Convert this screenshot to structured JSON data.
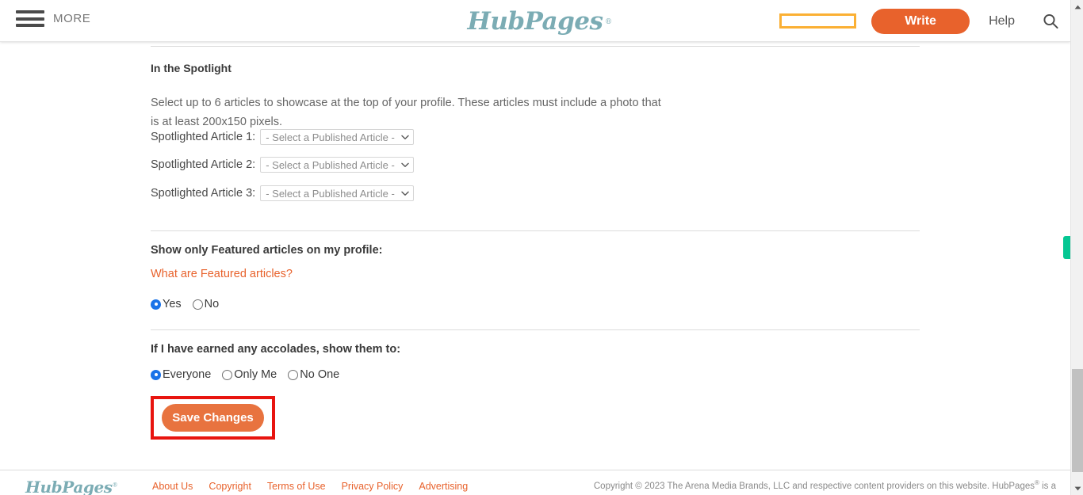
{
  "header": {
    "more_label": "MORE",
    "logo_text": "HubPages",
    "logo_reg": "®",
    "write_label": "Write",
    "help_label": "Help",
    "search_icon": "search-icon",
    "menu_icon": "hamburger-icon",
    "highlight_box": "",
    "brand_color": "#7bacb4",
    "accent_color": "#e8622c",
    "highlight_border_color": "#fbb034"
  },
  "main": {
    "section_title": "In the Spotlight",
    "section_description": "Select up to 6 articles to showcase at the top of your profile. These articles must include a photo that is at least 200x150 pixels.",
    "spotlight_rows": [
      {
        "label": "Spotlighted Article 1:",
        "value": "- Select a Published Article -"
      },
      {
        "label": "Spotlighted Article 2:",
        "value": "- Select a Published Article -"
      },
      {
        "label": "Spotlighted Article 3:",
        "value": "- Select a Published Article -"
      }
    ],
    "featured": {
      "question": "Show only Featured articles on my profile:",
      "link_text": "What are Featured articles?",
      "options": [
        {
          "label": "Yes",
          "selected": true
        },
        {
          "label": "No",
          "selected": false
        }
      ]
    },
    "accolades": {
      "question": "If I have earned any accolades, show them to:",
      "options": [
        {
          "label": "Everyone",
          "selected": true
        },
        {
          "label": "Only Me",
          "selected": false
        },
        {
          "label": "No One",
          "selected": false
        }
      ]
    },
    "save_label": "Save Changes",
    "save_highlight_color": "#e8140f"
  },
  "footer": {
    "logo_text": "HubPages",
    "logo_reg": "®",
    "links": [
      "About Us",
      "Copyright",
      "Terms of Use",
      "Privacy Policy",
      "Advertising"
    ],
    "copyright": "Copyright © 2023 The Arena Media Brands, LLC and respective content providers on this website. HubPages",
    "copyright_sup": "®",
    "copyright_tail": " is a"
  },
  "scrollbar": {
    "up_arrow": "scroll-up-arrow-icon",
    "down_arrow": "scroll-down-arrow-icon",
    "thumb": "scrollbar-thumb",
    "side_tab_color": "#05c793"
  }
}
